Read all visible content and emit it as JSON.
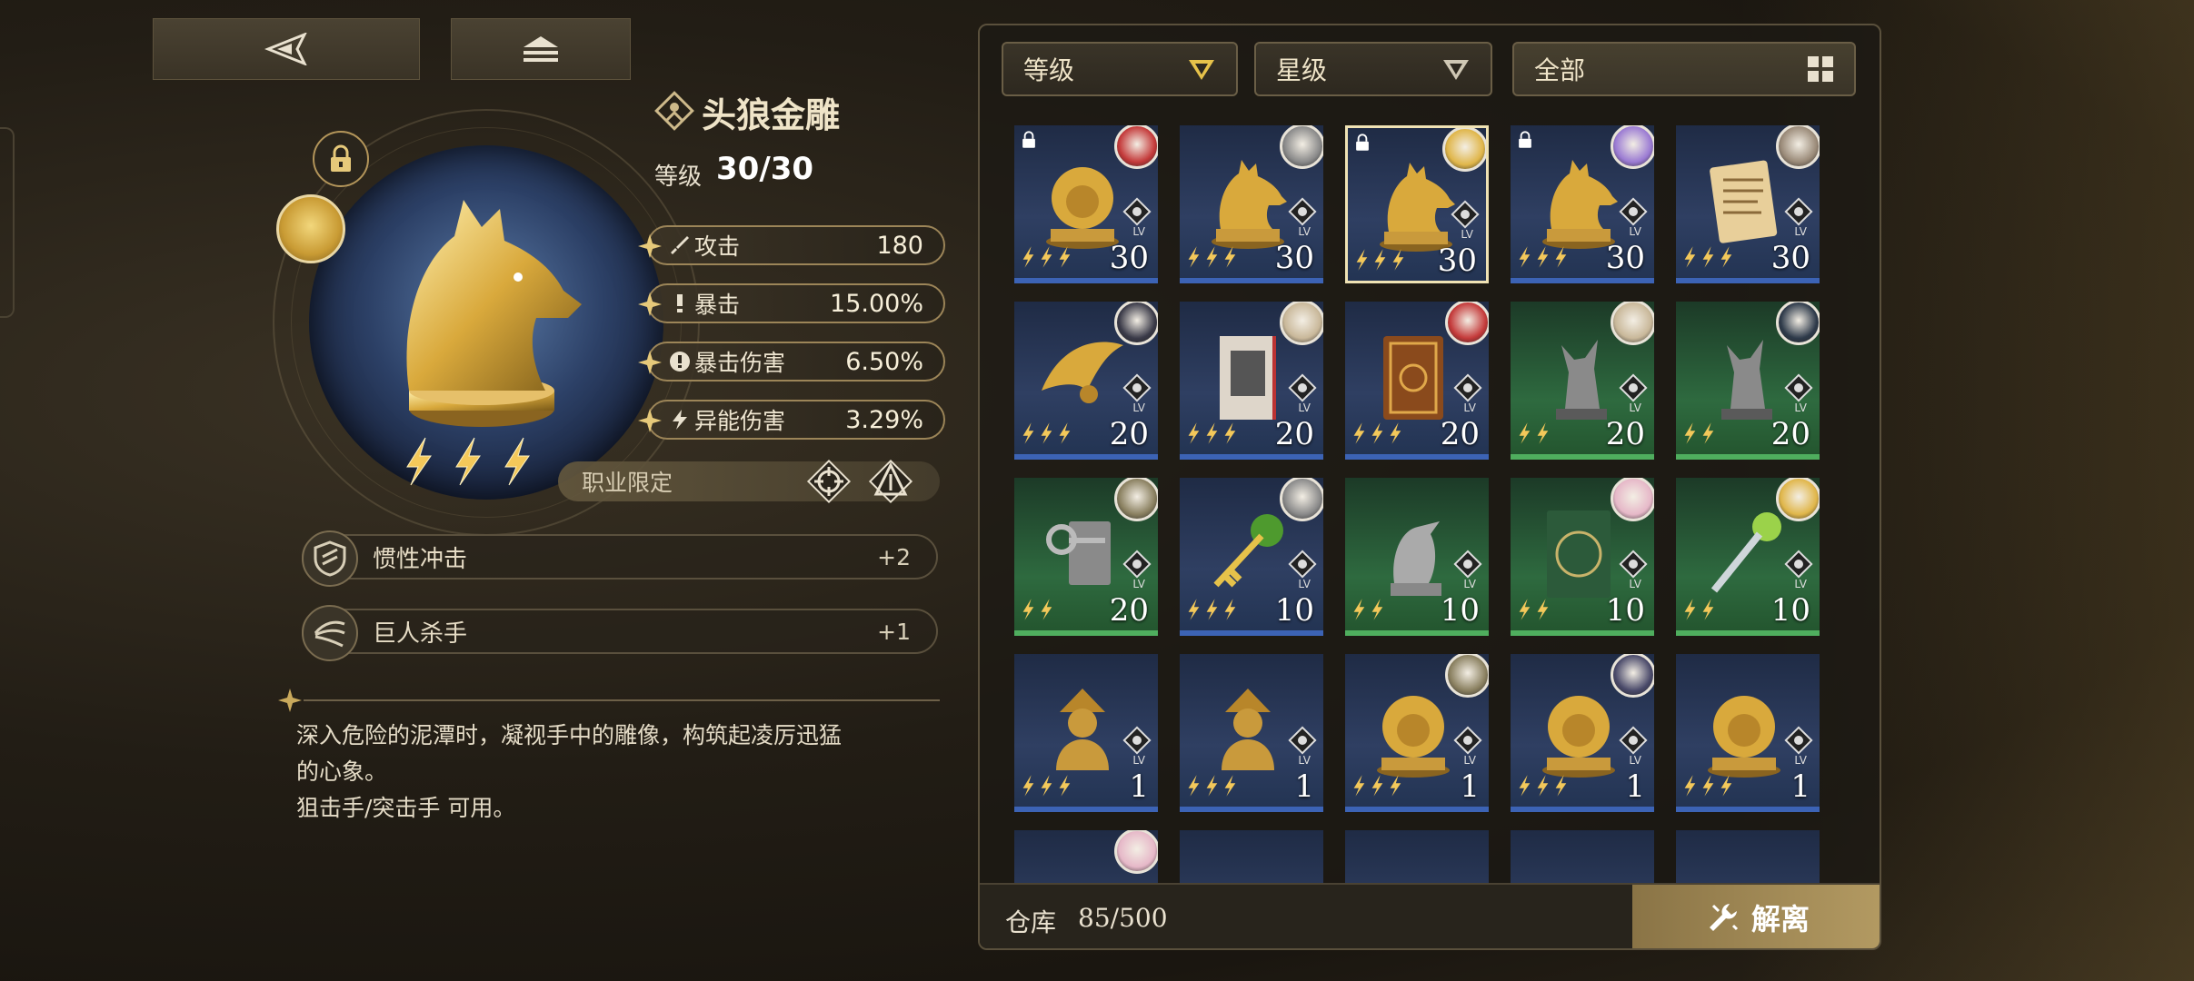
{
  "artifact": {
    "name": "头狼金雕",
    "level_label": "等级",
    "level_value": "30/30",
    "stars": 3
  },
  "stats": [
    {
      "label": "攻击",
      "value": "180"
    },
    {
      "label": "暴击",
      "value": "15.00%"
    },
    {
      "label": "暴击伤害",
      "value": "6.50%"
    },
    {
      "label": "异能伤害",
      "value": "3.29%"
    }
  ],
  "restriction_label": "职业限定",
  "skills": [
    {
      "label": "惯性冲击",
      "value": "+2"
    },
    {
      "label": "巨人杀手",
      "value": "+1"
    }
  ],
  "description": {
    "line1": "深入危险的泥潭时，凝视手中的雕像，构筑起凌厉迅猛",
    "line2": "的心象。",
    "line3": "狙击手/突击手 可用。"
  },
  "filters": {
    "level": "等级",
    "star": "星级",
    "all": "全部"
  },
  "inventory": [
    {
      "level": "30",
      "stars": 3,
      "bg": "blue",
      "art": "lion",
      "locked": true,
      "avatar": "#c43a3a"
    },
    {
      "level": "30",
      "stars": 3,
      "bg": "blue",
      "art": "wolf",
      "locked": false,
      "avatar": "#8a8a8a"
    },
    {
      "level": "30",
      "stars": 3,
      "bg": "blue",
      "art": "wolf",
      "locked": true,
      "avatar": "#e0b64a",
      "selected": true
    },
    {
      "level": "30",
      "stars": 3,
      "bg": "blue",
      "art": "wolf",
      "locked": true,
      "avatar": "#9b7bd3"
    },
    {
      "level": "30",
      "stars": 3,
      "bg": "blue",
      "art": "scroll",
      "locked": false,
      "avatar": "#9a8a78"
    },
    {
      "level": "20",
      "stars": 3,
      "bg": "blue",
      "art": "wing",
      "locked": false,
      "avatar": "#3a3a48"
    },
    {
      "level": "20",
      "stars": 3,
      "bg": "blue",
      "art": "book",
      "locked": false,
      "avatar": "#c9b89a"
    },
    {
      "level": "20",
      "stars": 3,
      "bg": "blue",
      "art": "tome",
      "locked": false,
      "avatar": "#c43a3a"
    },
    {
      "level": "20",
      "stars": 2,
      "bg": "green",
      "art": "wolfstatue",
      "locked": false,
      "avatar": "#c9b89a"
    },
    {
      "level": "20",
      "stars": 2,
      "bg": "green",
      "art": "wolfstatue",
      "locked": false,
      "avatar": "#2e3a4a"
    },
    {
      "level": "20",
      "stars": 2,
      "bg": "green",
      "art": "key",
      "locked": false,
      "avatar": "#8a8060"
    },
    {
      "level": "10",
      "stars": 3,
      "bg": "blue",
      "art": "goldkey",
      "locked": false,
      "avatar": "#8a8a8a"
    },
    {
      "level": "10",
      "stars": 2,
      "bg": "green",
      "art": "bird",
      "locked": false,
      "avatar": "none"
    },
    {
      "level": "10",
      "stars": 2,
      "bg": "green",
      "art": "greenbook",
      "locked": false,
      "avatar": "#e6b8c8"
    },
    {
      "level": "10",
      "stars": 2,
      "bg": "green",
      "art": "staff",
      "locked": false,
      "avatar": "#e0b64a"
    },
    {
      "level": "1",
      "stars": 3,
      "bg": "blue",
      "art": "bust",
      "locked": false,
      "avatar": "none"
    },
    {
      "level": "1",
      "stars": 3,
      "bg": "blue",
      "art": "bust",
      "locked": false,
      "avatar": "none"
    },
    {
      "level": "1",
      "stars": 3,
      "bg": "blue",
      "art": "lion",
      "locked": false,
      "avatar": "#8a8060"
    },
    {
      "level": "1",
      "stars": 3,
      "bg": "blue",
      "art": "lion",
      "locked": false,
      "avatar": "#4a4a6a"
    },
    {
      "level": "1",
      "stars": 3,
      "bg": "blue",
      "art": "lion",
      "locked": false,
      "avatar": "none"
    }
  ],
  "inventory_partial_row_avatar": "#e6b8c8",
  "storage": {
    "label": "仓库",
    "value": "85/500"
  },
  "dismantle_label": "解离",
  "colors": {
    "accent_gold": "#b39a62",
    "rarity_blue": "#3c63b5",
    "rarity_green": "#4fae5e"
  }
}
